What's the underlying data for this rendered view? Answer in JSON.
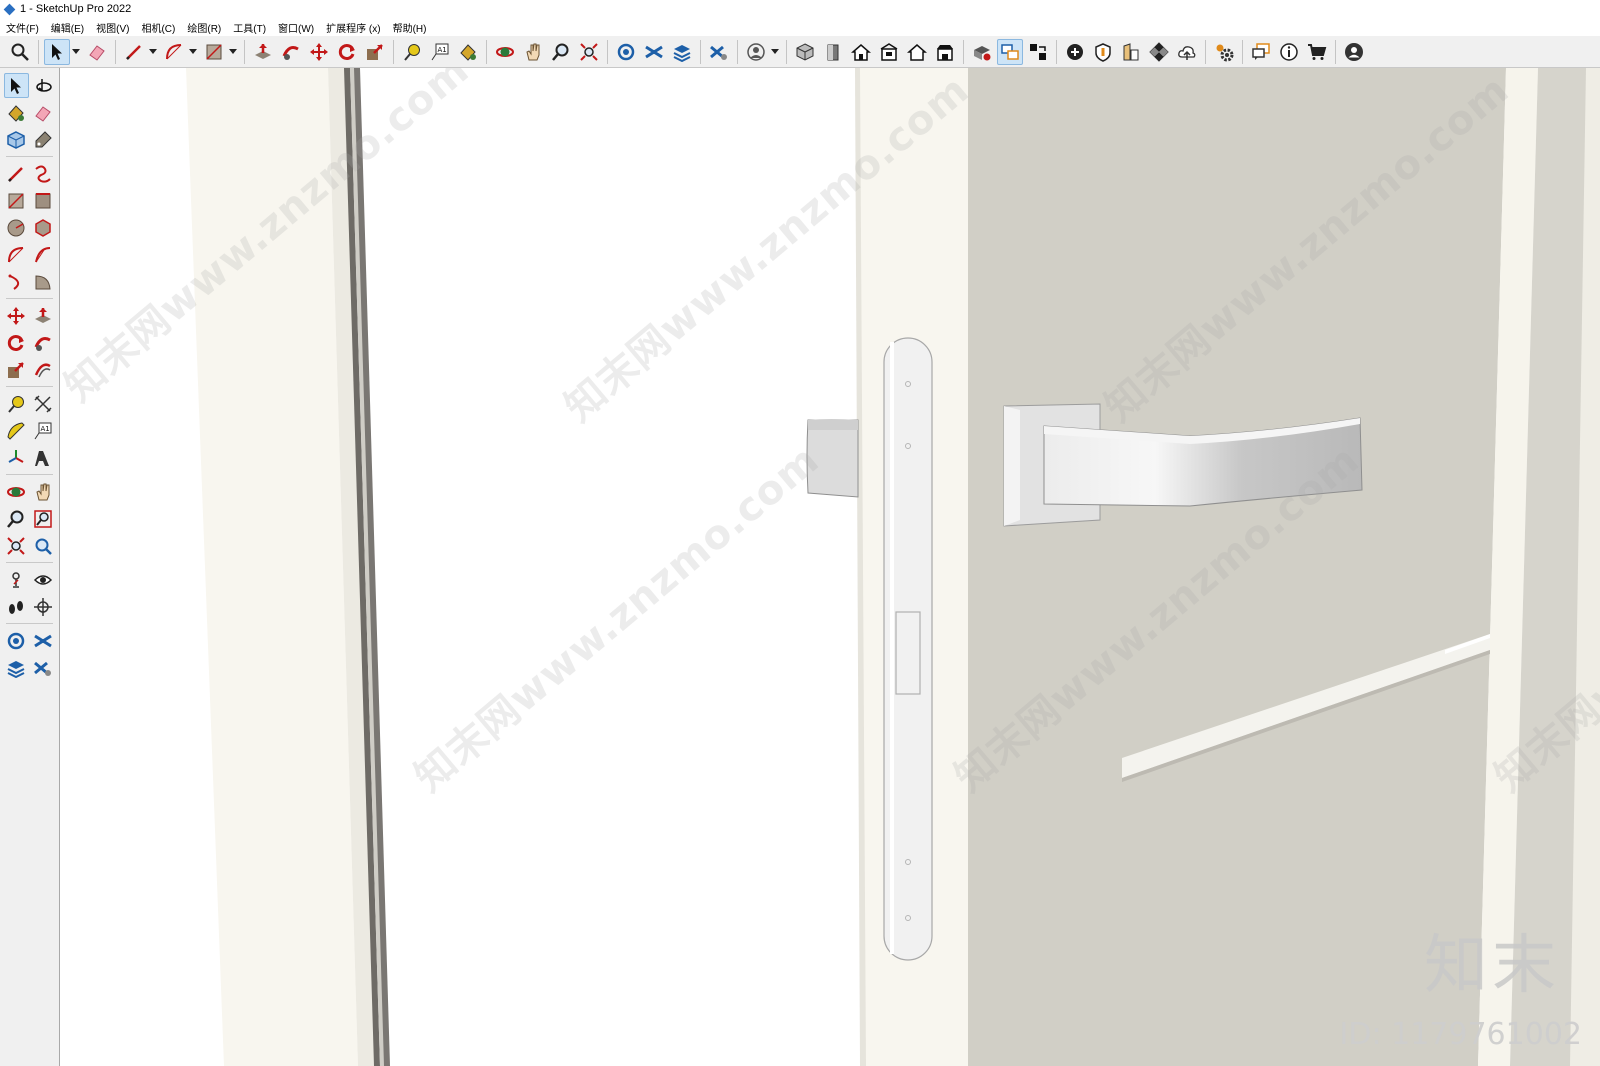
{
  "window": {
    "title": "1 - SketchUp Pro 2022"
  },
  "menu": [
    {
      "label": "文件(F)"
    },
    {
      "label": "编辑(E)"
    },
    {
      "label": "视图(V)"
    },
    {
      "label": "相机(C)"
    },
    {
      "label": "绘图(R)"
    },
    {
      "label": "工具(T)"
    },
    {
      "label": "窗口(W)"
    },
    {
      "label": "扩展程序 (x)"
    },
    {
      "label": "帮助(H)"
    }
  ],
  "toolbar": {
    "icons": [
      "search-icon",
      "select-icon",
      "eraser-icon",
      "pencil-icon",
      "arc-icon",
      "rectangle-icon",
      "push-pull-icon",
      "follow-me-icon",
      "move-icon",
      "rotate-icon",
      "scale-icon",
      "tape-measure-icon",
      "text-icon",
      "paint-bucket-icon",
      "orbit-icon",
      "pan-icon",
      "zoom-icon",
      "zoom-extents-icon",
      "warehouse-icon",
      "extension-warehouse-icon",
      "layout-icon",
      "extension-manager-icon",
      "account-icon",
      "iso-view-icon",
      "top-view-icon",
      "front-view-icon",
      "right-view-icon",
      "back-view-icon",
      "left-view-icon",
      "solid-tools-icon",
      "outer-shell-icon",
      "section-icon",
      "add-location-icon",
      "sandbox-icon",
      "photo-texture-icon",
      "checker-icon",
      "upload-icon",
      "settings-icon",
      "comment-icon",
      "info-icon",
      "cart-icon",
      "profile-icon"
    ]
  },
  "left_toolbar": {
    "icons": [
      "select-arrow-icon",
      "orbit-icon",
      "paint-bucket-icon",
      "eraser-icon",
      "component-icon",
      "tag-icon",
      "line-icon",
      "freehand-icon",
      "rectangle-icon",
      "rotated-rectangle-icon",
      "circle-icon",
      "polygon-icon",
      "arc-icon",
      "two-point-arc-icon",
      "three-point-arc-icon",
      "pie-icon",
      "move-icon",
      "push-pull-icon",
      "rotate-icon",
      "follow-me-icon",
      "scale-icon",
      "offset-icon",
      "tape-measure-icon",
      "dimension-icon",
      "protractor-icon",
      "text-icon",
      "axes-icon",
      "3d-text-icon",
      "orbit-icon",
      "pan-icon",
      "zoom-icon",
      "zoom-window-icon",
      "zoom-extents-icon",
      "previous-view-icon",
      "position-camera-icon",
      "look-around-icon",
      "walk-icon",
      "section-plane-icon",
      "warehouse-icon",
      "extension-warehouse-icon",
      "layers-icon",
      "share-icon"
    ]
  },
  "watermarks": {
    "site": "知末网www.znzmo.com",
    "brand": "知末",
    "id_text": "ID: 1179761002"
  },
  "colors": {
    "wall": "#f8f6ef",
    "door_panel": "#d1cfc6",
    "toolbar_bg": "#f0f0f0",
    "highlight": "#cde4f7"
  }
}
